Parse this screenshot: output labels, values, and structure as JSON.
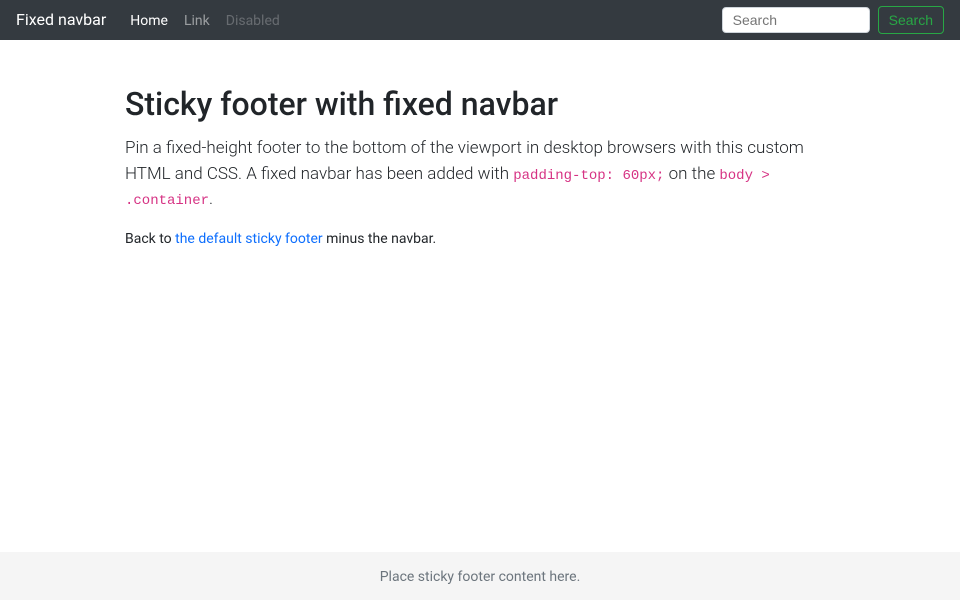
{
  "navbar": {
    "brand": "Fixed navbar",
    "items": [
      {
        "label": "Home",
        "active": true,
        "disabled": false
      },
      {
        "label": "Link",
        "active": false,
        "disabled": false
      },
      {
        "label": "Disabled",
        "active": false,
        "disabled": true
      }
    ],
    "search": {
      "placeholder": "Search",
      "button_label": "Search"
    }
  },
  "main": {
    "heading": "Sticky footer with fixed navbar",
    "lead_part1": "Pin a fixed-height footer to the bottom of the viewport in desktop browsers with this custom HTML and CSS. A fixed navbar has been added with ",
    "code1": "padding-top: 60px;",
    "lead_part2": " on the ",
    "code2": "body > .container",
    "lead_part3": ".",
    "back_part1": "Back to ",
    "back_link": "the default sticky footer",
    "back_part2": " minus the navbar."
  },
  "footer": {
    "text": "Place sticky footer content here."
  }
}
